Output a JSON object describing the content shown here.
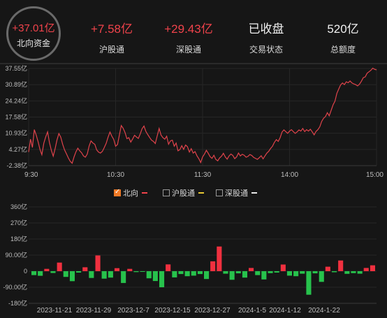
{
  "header": {
    "northbound": {
      "value": "+37.01亿",
      "label": "北向资金"
    },
    "stats": [
      {
        "value": "+7.58亿",
        "label": "沪股通",
        "color": "#f0434b"
      },
      {
        "value": "+29.43亿",
        "label": "深股通",
        "color": "#f0434b"
      },
      {
        "value": "已收盘",
        "label": "交易状态",
        "color": "#f0f0f0"
      },
      {
        "value": "520亿",
        "label": "总额度",
        "color": "#f0f0f0"
      }
    ]
  },
  "legend": [
    {
      "label": "北向",
      "checked": true,
      "color": "#f0434b"
    },
    {
      "label": "沪股通",
      "checked": false,
      "color": "#e8c833"
    },
    {
      "label": "深股通",
      "checked": false,
      "color": "#e8e8e8"
    }
  ],
  "chart_data": [
    {
      "type": "line",
      "name": "intraday",
      "y_ticks": [
        "37.55亿",
        "30.89亿",
        "24.24亿",
        "17.58亿",
        "10.93亿",
        "4.27亿",
        "-2.38亿"
      ],
      "ylim": [
        -2.38,
        37.55
      ],
      "x_ticks": [
        "9:30",
        "10:30",
        "11:30",
        "14:00",
        "15:00"
      ],
      "series": [
        {
          "color": "#e0434b",
          "values": [
            3.2,
            8.5,
            5.1,
            12.4,
            10.2,
            7.5,
            4.3,
            2.1,
            6.8,
            9.4,
            11.5,
            7.1,
            3.9,
            1.5,
            4.6,
            8.2,
            10.8,
            9.3,
            6.4,
            4.1,
            2.5,
            0.8,
            -0.6,
            -1.4,
            1.2,
            3.3,
            4.8,
            3.7,
            2.9,
            1.6,
            1.1,
            2.4,
            5.7,
            7.8,
            6.9,
            6.4,
            4.1,
            3.2,
            2.8,
            3.5,
            5.1,
            6.8,
            9.3,
            11.4,
            9.7,
            8.4,
            5.6,
            6.3,
            10.2,
            14.1,
            13.0,
            11.2,
            8.7,
            9.1,
            7.3,
            8.6,
            10.1,
            9.4,
            8.8,
            10.6,
            12.8,
            13.9,
            11.7,
            10.4,
            9.2,
            8.1,
            7.6,
            6.7,
            9.8,
            12.9,
            10.2,
            9.1,
            8.5,
            9.7,
            6.4,
            7.8,
            8.1,
            5.6,
            6.9,
            3.7,
            4.2,
            5.8,
            4.3,
            6.1,
            5.4,
            3.2,
            4.6,
            2.8,
            3.4,
            1.7,
            0.5,
            -1.1,
            1.2,
            2.4,
            3.9,
            2.7,
            1.3,
            0.6,
            1.9,
            0.2,
            -0.4,
            0.8,
            1.5,
            2.7,
            1.2,
            0.3,
            1.6,
            2.4,
            1.8,
            0.5,
            1.2,
            2.8,
            1.6,
            2.3,
            1.9,
            1.1,
            1.4,
            2.2,
            1.8,
            1.0,
            0.6,
            0.2,
            0.9,
            1.7,
            0.4,
            1.6,
            2.8,
            3.5,
            4.7,
            5.6,
            7.2,
            8.3,
            7.6,
            9.1,
            11.4,
            12.3,
            11.6,
            10.9,
            11.8,
            12.4,
            11.6,
            10.9,
            11.5,
            12.3,
            11.8,
            12.9,
            11.6,
            12.4,
            11.8,
            12.6,
            11.5,
            10.3,
            11.7,
            12.4,
            13.6,
            15.8,
            17.1,
            17.8,
            19.4,
            18.1,
            20.3,
            22.6,
            24.1,
            27.3,
            29.1,
            30.8,
            31.6,
            30.9,
            32.1,
            31.7,
            32.4,
            31.6,
            31.2,
            30.9,
            30.4,
            31.1,
            32.3,
            33.8,
            34.1,
            35.6,
            36.2,
            36.8,
            37.7,
            37.2,
            37.01
          ]
        }
      ]
    },
    {
      "type": "bar",
      "name": "daily",
      "y_ticks": [
        "360亿",
        "270亿",
        "180亿",
        "90.00亿",
        "0",
        "-90.00亿",
        "-180亿"
      ],
      "ylim": [
        -180,
        360
      ],
      "x_ticks": [
        "2023-11-21",
        "2023-11-29",
        "2023-12-7",
        "2023-12-15",
        "2023-12-27",
        "2024-1-5",
        "2024-1-12",
        "2024-1-22"
      ],
      "up_color": "#f0303f",
      "down_color": "#27c24c",
      "values": [
        -22,
        -26,
        13,
        -10,
        48,
        -32,
        -56,
        -8,
        22,
        -38,
        88,
        -42,
        -36,
        17,
        -66,
        13,
        -5,
        -4,
        -40,
        -55,
        -90,
        38,
        -35,
        -16,
        -28,
        -25,
        -16,
        -44,
        55,
        138,
        -14,
        -48,
        -12,
        -36,
        18,
        -22,
        -46,
        -11,
        -8,
        37,
        -25,
        -28,
        -14,
        -132,
        -12,
        -60,
        25,
        -6,
        60,
        -15,
        -11,
        -14,
        18,
        33
      ]
    }
  ]
}
